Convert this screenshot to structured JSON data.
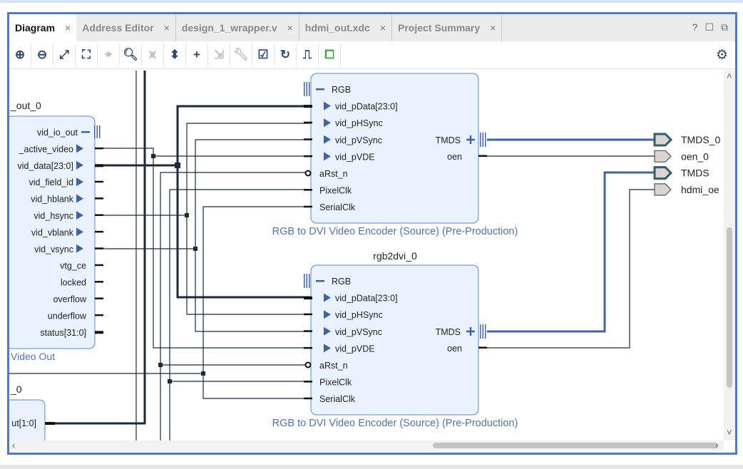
{
  "tabs": [
    {
      "label": "Diagram",
      "active": true
    },
    {
      "label": "Address Editor"
    },
    {
      "label": "design_1_wrapper.v"
    },
    {
      "label": "hdmi_out.xdc"
    },
    {
      "label": "Project Summary"
    }
  ],
  "tab_close": "×",
  "window_buttons": {
    "help": "?",
    "maximize": "☐",
    "float": "⧉"
  },
  "toolbar": [
    "zoom-in",
    "zoom-out",
    "fit-full",
    "zoom-fit-selection",
    "auto-connect",
    "search",
    "collapse-all",
    "expand-all",
    "add-ip",
    "make-external",
    "properties",
    "validate-design",
    "regenerate-layout",
    "optimize-routing",
    "add-module"
  ],
  "diagram": {
    "left_block": {
      "name": "_out_0",
      "caption": "Video Out",
      "pins": [
        "vid_io_out",
        "_active_video",
        "vid_data[23:0]",
        "vid_field_id",
        "vid_hblank",
        "vid_hsync",
        "vid_vblank",
        "vid_vsync",
        "vtg_ce",
        "locked",
        "overflow",
        "underflow",
        "status[31:0]"
      ]
    },
    "left_block2": {
      "name": "_0",
      "pins": [
        "ut[1:0]"
      ]
    },
    "encoder1": {
      "name": "",
      "caption": "RGB to DVI Video Encoder (Source) (Pre-Production)",
      "inputs": [
        "RGB",
        "vid_pData[23:0]",
        "vid_pHSync",
        "vid_pVSync",
        "vid_pVDE",
        "aRst_n",
        "PixelClk",
        "SerialClk"
      ],
      "outputs": [
        "TMDS",
        "oen"
      ]
    },
    "encoder2": {
      "name": "rgb2dvi_0",
      "caption": "RGB to DVI Video Encoder (Source) (Pre-Production)",
      "inputs": [
        "RGB",
        "vid_pData[23:0]",
        "vid_pHSync",
        "vid_pVSync",
        "vid_pVDE",
        "aRst_n",
        "PixelClk",
        "SerialClk"
      ],
      "outputs": [
        "TMDS",
        "oen"
      ]
    },
    "ports": [
      "TMDS_0",
      "oen_0",
      "TMDS",
      "hdmi_oe"
    ]
  },
  "colors": {
    "frame": "#4a7bd0",
    "block_fill": "#eaf3fd",
    "block_border": "#5b86c9",
    "wire": "#1b2a3d",
    "bus_blue": "#3f63a8",
    "caption": "#4d72b6",
    "port_fill": "#dcd4d0"
  }
}
